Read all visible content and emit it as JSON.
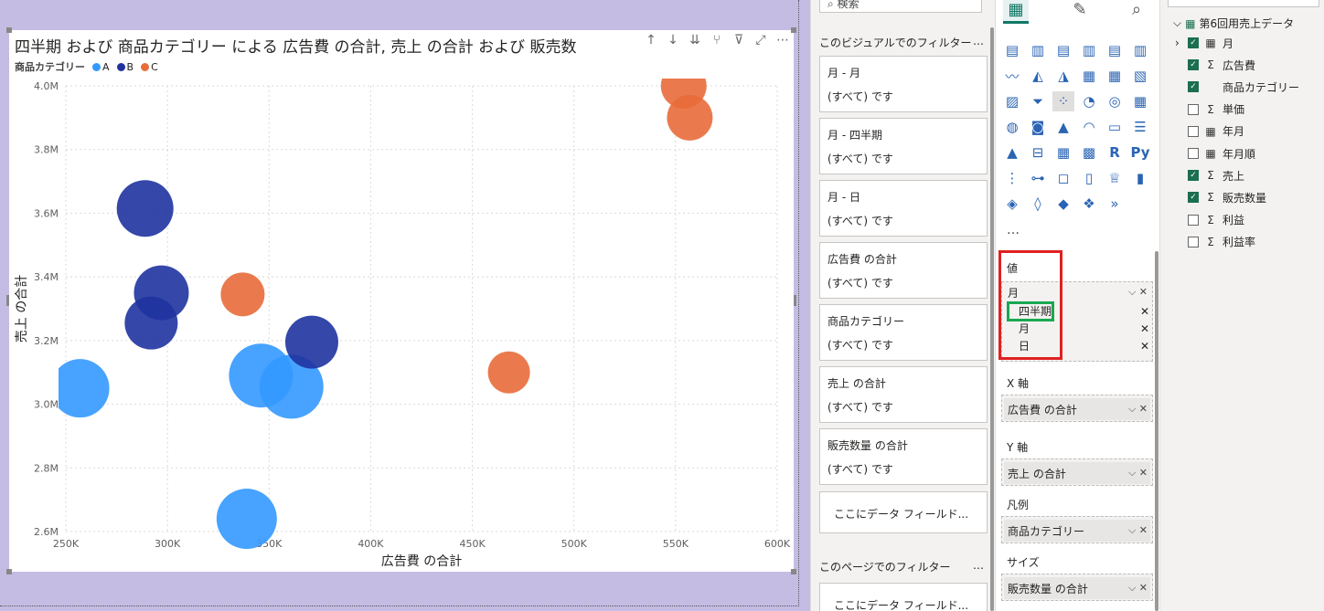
{
  "visual": {
    "title": "四半期 および 商品カテゴリー による 広告費 の合計, 売上 の合計 および 販売数",
    "legend_title": "商品カテゴリー",
    "toolbar_icons": [
      "arrow-up-icon",
      "arrow-down-icon",
      "expand-all-icon",
      "drill-down-icon",
      "filter-icon",
      "focus-mode-icon",
      "more-options-icon"
    ]
  },
  "chart_data": {
    "type": "scatter",
    "xlabel": "広告費 の合計",
    "ylabel": "売上 の合計",
    "xlim": [
      250000,
      600000
    ],
    "ylim": [
      2600000,
      4000000
    ],
    "xticks": [
      "250K",
      "300K",
      "350K",
      "400K",
      "450K",
      "500K",
      "550K",
      "600K"
    ],
    "yticks": [
      "2.6M",
      "2.8M",
      "3.0M",
      "3.2M",
      "3.4M",
      "3.6M",
      "3.8M",
      "4.0M"
    ],
    "grid": true,
    "legend_placement": "top-left",
    "series": [
      {
        "name": "A",
        "color": "#3399ff",
        "points": [
          {
            "x": 257000,
            "y": 3050000,
            "r": 32
          },
          {
            "x": 346000,
            "y": 3090000,
            "r": 35
          },
          {
            "x": 361000,
            "y": 3055000,
            "r": 35
          },
          {
            "x": 339000,
            "y": 2640000,
            "r": 33
          }
        ]
      },
      {
        "name": "B",
        "color": "#1f33a0",
        "points": [
          {
            "x": 289000,
            "y": 3615000,
            "r": 31
          },
          {
            "x": 297000,
            "y": 3350000,
            "r": 30
          },
          {
            "x": 292000,
            "y": 3255000,
            "r": 29
          },
          {
            "x": 371000,
            "y": 3195000,
            "r": 29
          }
        ]
      },
      {
        "name": "C",
        "color": "#e86c3a",
        "points": [
          {
            "x": 554000,
            "y": 4000000,
            "r": 25
          },
          {
            "x": 557000,
            "y": 3900000,
            "r": 25
          },
          {
            "x": 337000,
            "y": 3345000,
            "r": 24
          },
          {
            "x": 468000,
            "y": 3100000,
            "r": 23
          }
        ]
      }
    ]
  },
  "filter_pane": {
    "search_placeholder": "検索",
    "visual_section": "このビジュアルでのフィルター",
    "more": "…",
    "cards": [
      {
        "title": "月 - 月",
        "value": "(すべて) です"
      },
      {
        "title": "月 - 四半期",
        "value": "(すべて) です"
      },
      {
        "title": "月 - 日",
        "value": "(すべて) です"
      },
      {
        "title": "広告費 の合計",
        "value": "(すべて) です"
      },
      {
        "title": "商品カテゴリー",
        "value": "(すべて) です"
      },
      {
        "title": "売上 の合計",
        "value": "(すべて) です"
      },
      {
        "title": "販売数量 の合計",
        "value": "(すべて) です"
      }
    ],
    "drop_text": "ここにデータ フィールド...",
    "page_section": "このページでのフィルター",
    "page_drop_text": "ここにデータ フィールド..."
  },
  "viz_pane": {
    "more": "…",
    "wells": {
      "values_label": "値",
      "values_field": "月",
      "hierarchy": [
        "四半期",
        "月",
        "日"
      ],
      "x_label": "X 軸",
      "x_field": "広告費 の合計",
      "y_label": "Y 軸",
      "y_field": "売上 の合計",
      "legend_label": "凡例",
      "legend_field": "商品カテゴリー",
      "size_label": "サイズ",
      "size_field": "販売数量 の合計"
    }
  },
  "fields_pane": {
    "table_name": "第6回用売上データ",
    "fields": [
      {
        "label": "月",
        "icon": "calendar-icon",
        "checked": true,
        "expandable": true
      },
      {
        "label": "広告費",
        "icon": "sigma-icon",
        "checked": true
      },
      {
        "label": "商品カテゴリー",
        "icon": "",
        "checked": true
      },
      {
        "label": "単価",
        "icon": "sigma-icon",
        "checked": false
      },
      {
        "label": "年月",
        "icon": "calendar-icon",
        "checked": false
      },
      {
        "label": "年月順",
        "icon": "calendar-icon",
        "checked": false
      },
      {
        "label": "売上",
        "icon": "sigma-icon",
        "checked": true
      },
      {
        "label": "販売数量",
        "icon": "sigma-icon",
        "checked": true
      },
      {
        "label": "利益",
        "icon": "sigma-icon",
        "checked": false
      },
      {
        "label": "利益率",
        "icon": "sigma-icon",
        "checked": false
      }
    ]
  }
}
